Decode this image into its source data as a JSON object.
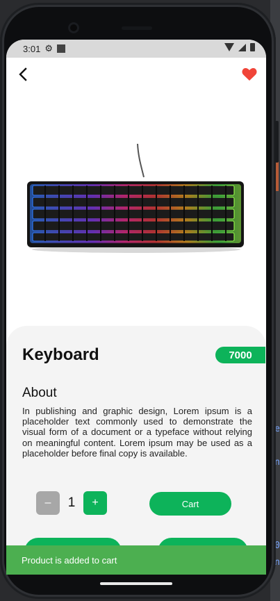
{
  "status_bar": {
    "time": "3:01",
    "settings_icon": "gear-icon",
    "notification_icon": "square-icon"
  },
  "nav": {
    "back_icon": "chevron-left-icon",
    "favorite_icon": "heart-icon",
    "favorite_color": "#f04438"
  },
  "product": {
    "image": "keyboard-image",
    "name": "Keyboard",
    "price": "7000",
    "about_heading": "About",
    "about_text": "In publishing and graphic design, Lorem ipsum is a placeholder text commonly used to demonstrate the visual form of a document or a typeface without relying on meaningful content. Lorem ipsum may be used as a placeholder before final copy is available."
  },
  "quantity": {
    "minus_label": "–",
    "value": "1",
    "plus_label": "+"
  },
  "actions": {
    "cart_label": "Cart"
  },
  "toast": {
    "message": "Product is added to cart"
  },
  "colors": {
    "accent": "#0db35a",
    "toast": "#4caf50",
    "sheet": "#f4f4f4"
  }
}
